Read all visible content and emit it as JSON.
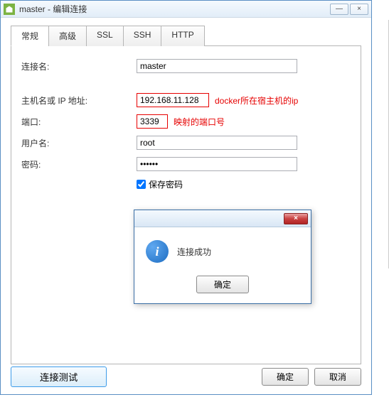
{
  "window": {
    "title": "master - 编辑连接",
    "minimize": "—",
    "close": "×"
  },
  "tabs": {
    "general": "常规",
    "advanced": "高级",
    "ssl": "SSL",
    "ssh": "SSH",
    "http": "HTTP"
  },
  "form": {
    "connection_name_label": "连接名:",
    "connection_name_value": "master",
    "host_label": "主机名或 IP 地址:",
    "host_value": "192.168.11.128",
    "host_annotation": "docker所在宿主机的ip",
    "port_label": "端口:",
    "port_value": "3339",
    "port_annotation": "映射的端口号",
    "username_label": "用户名:",
    "username_value": "root",
    "password_label": "密码:",
    "password_value": "••••••",
    "save_password_label": "保存密码"
  },
  "modal": {
    "message": "连接成功",
    "ok": "确定",
    "close": "×"
  },
  "buttons": {
    "test": "连接测试",
    "ok": "确定",
    "cancel": "取消"
  }
}
